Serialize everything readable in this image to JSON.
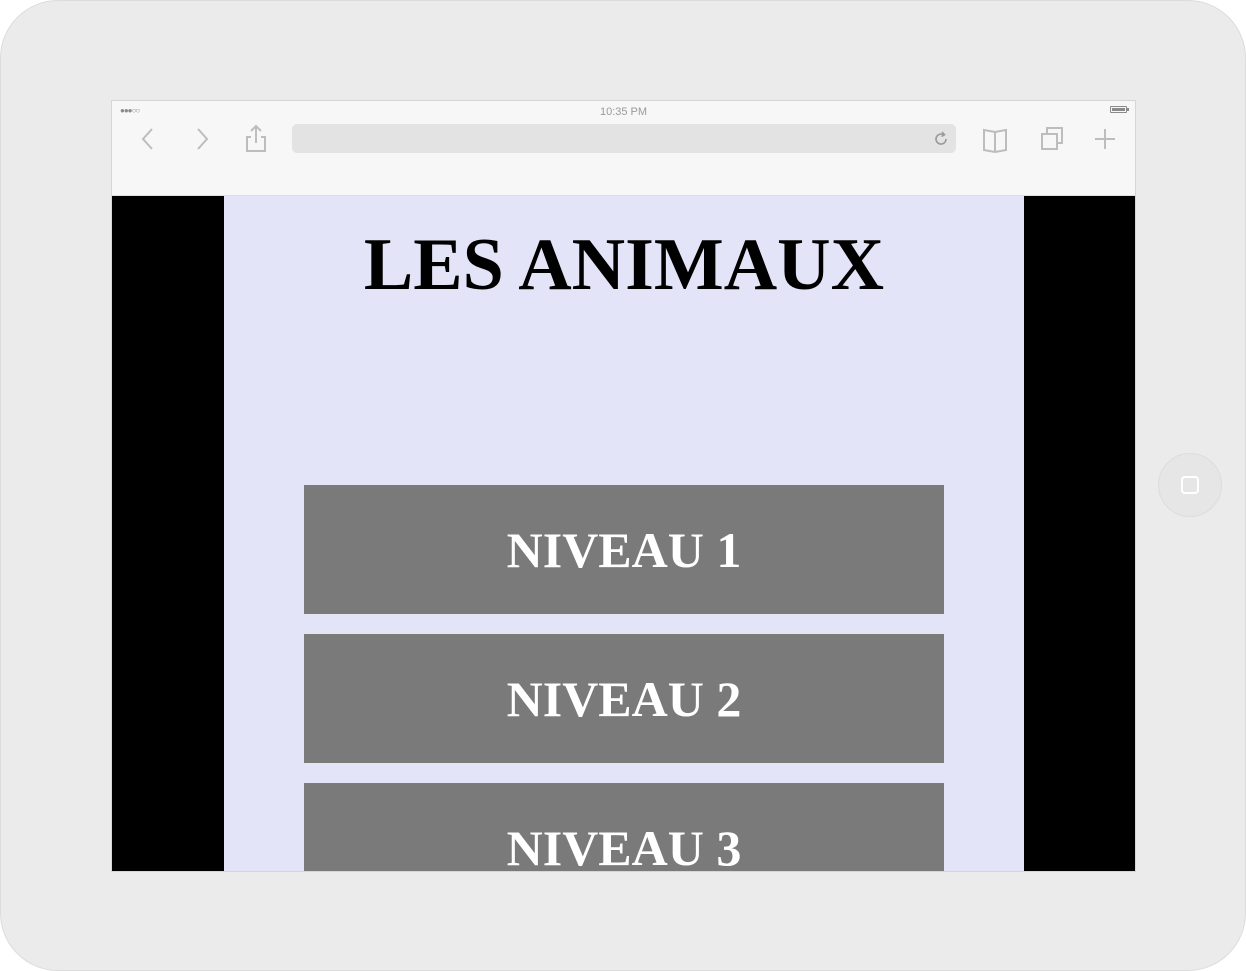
{
  "status_bar": {
    "time": "10:35 PM",
    "signal": "●●●○○"
  },
  "browser": {
    "url": ""
  },
  "page": {
    "title": "LES ANIMAUX",
    "levels": [
      {
        "label": "NIVEAU 1"
      },
      {
        "label": "NIVEAU 2"
      },
      {
        "label": "NIVEAU 3"
      }
    ]
  },
  "colors": {
    "page_background": "#e4e4f8",
    "button_background": "#7a7a7a",
    "button_text": "#ffffff",
    "side_bars": "#000000"
  }
}
